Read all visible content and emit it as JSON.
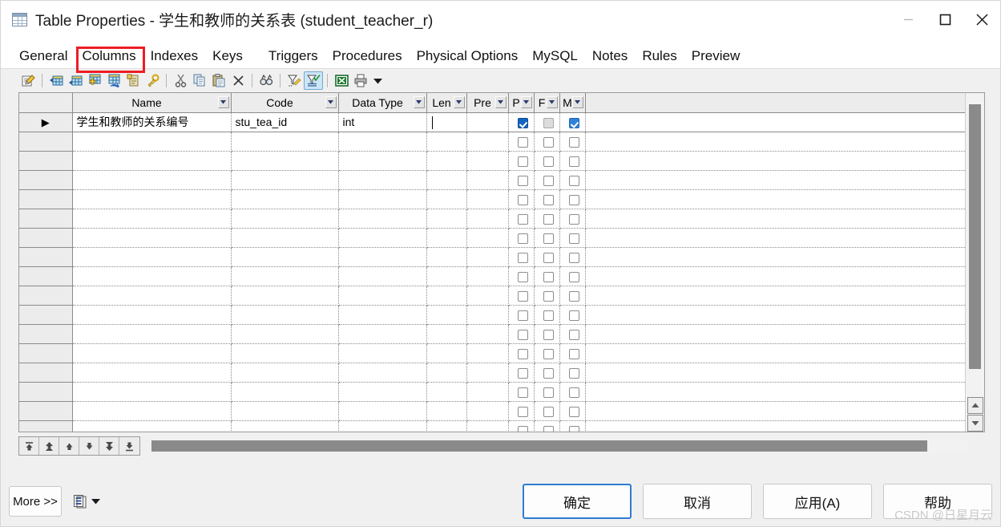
{
  "window": {
    "title": "Table Properties - 学生和教师的关系表 (student_teacher_r)",
    "icon": "table-icon",
    "controls": {
      "minimize": "minimize-icon",
      "maximize": "maximize-icon",
      "close": "close-icon"
    }
  },
  "tabs": {
    "items": [
      {
        "label": "General",
        "selected": false
      },
      {
        "label": "Columns",
        "selected": true
      },
      {
        "label": "Indexes",
        "selected": false
      },
      {
        "label": "Keys",
        "selected": false
      },
      {
        "label": "Triggers",
        "selected": false
      },
      {
        "label": "Procedures",
        "selected": false
      },
      {
        "label": "Physical Options",
        "selected": false
      },
      {
        "label": "MySQL",
        "selected": false
      },
      {
        "label": "Notes",
        "selected": false
      },
      {
        "label": "Rules",
        "selected": false
      },
      {
        "label": "Preview",
        "selected": false
      }
    ],
    "highlight_color": "#ee1c25",
    "highlighted_tab": "Columns"
  },
  "toolbar": {
    "items": [
      {
        "name": "properties-icon",
        "title": "Properties"
      },
      {
        "name": "insert-row-icon",
        "title": "Insert a Row"
      },
      {
        "name": "add-row-icon",
        "title": "Add a Row"
      },
      {
        "name": "add-table-icon",
        "title": "Add Object"
      },
      {
        "name": "replicate-icon",
        "title": "Replicate Object"
      },
      {
        "name": "paste-object-icon",
        "title": "Paste Object"
      },
      {
        "name": "key-icon",
        "title": "Primary Key"
      },
      {
        "name": "cut-icon",
        "title": "Cut"
      },
      {
        "name": "copy-icon",
        "title": "Copy"
      },
      {
        "name": "paste-icon",
        "title": "Paste"
      },
      {
        "name": "delete-icon",
        "title": "Delete"
      },
      {
        "name": "find-icon",
        "title": "Find"
      },
      {
        "name": "filter-edit-icon",
        "title": "Customize Columns and Filter"
      },
      {
        "name": "filter-apply-icon",
        "title": "Apply Filter",
        "active": true
      },
      {
        "name": "excel-export-icon",
        "title": "Export to Excel"
      },
      {
        "name": "print-icon",
        "title": "Print"
      },
      {
        "name": "toolbar-overflow-caret-icon",
        "title": "More"
      }
    ]
  },
  "grid": {
    "columns": [
      {
        "key": "gutter",
        "label": "",
        "dropdown": false
      },
      {
        "key": "name",
        "label": "Name",
        "dropdown": true
      },
      {
        "key": "code",
        "label": "Code",
        "dropdown": true
      },
      {
        "key": "data_type",
        "label": "Data Type",
        "dropdown": true
      },
      {
        "key": "len",
        "label": "Len",
        "dropdown": true
      },
      {
        "key": "pre",
        "label": "Pre",
        "dropdown": true
      },
      {
        "key": "p",
        "label": "P",
        "dropdown": true
      },
      {
        "key": "f",
        "label": "F",
        "dropdown": true
      },
      {
        "key": "m",
        "label": "M",
        "dropdown": true
      },
      {
        "key": "pad",
        "label": "",
        "dropdown": false
      }
    ],
    "rows": [
      {
        "indicator": "▶",
        "name": "学生和教师的关系编号",
        "code": "stu_tea_id",
        "data_type": "int",
        "len": "",
        "len_caret": true,
        "pre": "",
        "p": "checked",
        "f": "disabled",
        "m": "checked-light"
      }
    ],
    "empty_row_count": 16,
    "vertical_scrollbar": {
      "name": "grid-vertical-scrollbar"
    },
    "horizontal_scrollbar": {
      "name": "grid-horizontal-scrollbar"
    }
  },
  "row_nav": {
    "buttons": [
      {
        "name": "move-to-top-button",
        "glyph": "top"
      },
      {
        "name": "move-up-fast-button",
        "glyph": "up-fast"
      },
      {
        "name": "move-up-button",
        "glyph": "up"
      },
      {
        "name": "move-down-button",
        "glyph": "down"
      },
      {
        "name": "move-down-fast-button",
        "glyph": "down-fast"
      },
      {
        "name": "move-to-bottom-button",
        "glyph": "bottom"
      }
    ]
  },
  "footer": {
    "more_label": "More >>",
    "report_icon": "report-icon",
    "report_caret_icon": "chevron-down-icon",
    "ok_label": "确定",
    "cancel_label": "取消",
    "apply_label": "应用(A)",
    "help_label": "帮助",
    "focus_color": "#2d7dd2"
  },
  "watermark": {
    "text": "CSDN @日星月云"
  }
}
